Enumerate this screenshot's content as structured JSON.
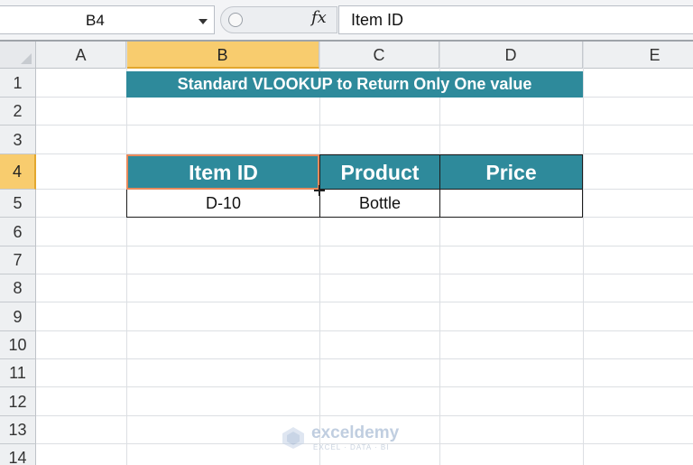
{
  "formula_bar": {
    "name_box": "B4",
    "fx_label": "fx",
    "formula_value": "Item ID"
  },
  "columns": [
    "A",
    "B",
    "C",
    "D",
    "E"
  ],
  "rows": [
    "1",
    "2",
    "3",
    "4",
    "5",
    "6",
    "7",
    "8",
    "9",
    "10",
    "11",
    "12",
    "13",
    "14"
  ],
  "sheet": {
    "title": "Standard VLOOKUP to Return Only One value",
    "table_headers": [
      "Item ID",
      "Product",
      "Price"
    ],
    "table_rows": [
      [
        "D-10",
        "Bottle",
        ""
      ]
    ]
  },
  "watermark": {
    "name": "exceldemy",
    "tagline": "EXCEL · DATA · BI"
  },
  "colors": {
    "header_fill": "#2e8a9b",
    "active_header": "#f8cc6e",
    "selection_border": "#e88a5c"
  }
}
